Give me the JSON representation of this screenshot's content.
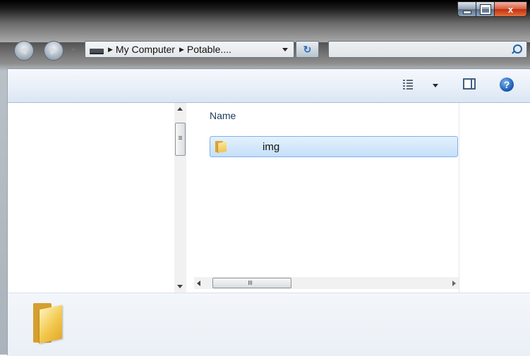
{
  "window": {
    "caption_buttons": {
      "minimize": "",
      "maximize": "",
      "close": "x"
    }
  },
  "navbar": {
    "breadcrumbs": [
      "My Computer",
      "Potable...."
    ],
    "refresh_icon": "refresh-icon",
    "search_placeholder": ""
  },
  "toolbar": {
    "icons": [
      "views-icon",
      "preview-pane-icon",
      "help-icon"
    ],
    "help_glyph": "?"
  },
  "file_list": {
    "columns": [
      "Name"
    ],
    "items": [
      {
        "name": "img",
        "type": "folder",
        "selected": true
      }
    ]
  },
  "details_pane": {
    "selected_name": ""
  },
  "colors": {
    "selection_bg": "#cce4fb",
    "selection_border": "#7fb1e8",
    "toolbar_bg": "#e4edf7",
    "close_button": "#c7462b"
  }
}
